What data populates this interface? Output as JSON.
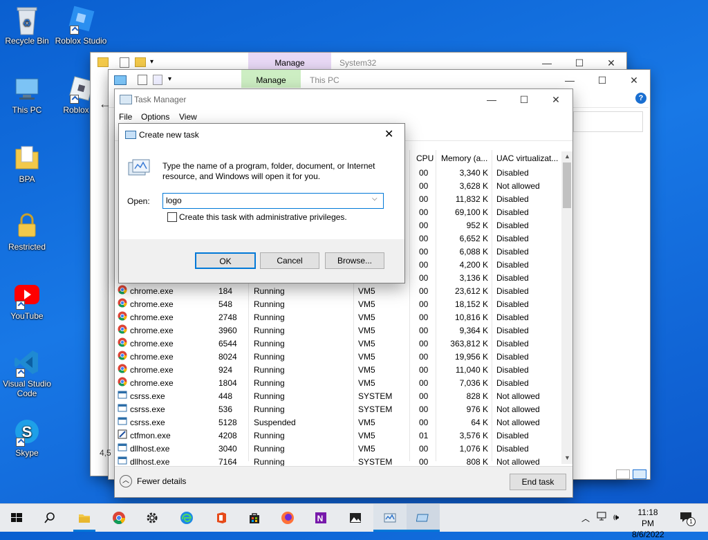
{
  "desktop": {
    "icons": [
      {
        "label": "Recycle Bin"
      },
      {
        "label": "Roblox Studio"
      },
      {
        "label": "This PC"
      },
      {
        "label": "Roblox Pl"
      },
      {
        "label": "BPA"
      },
      {
        "label": "Restricted"
      },
      {
        "label": "YouTube"
      },
      {
        "label": "Visual Studio Code"
      },
      {
        "label": "Skype"
      }
    ]
  },
  "explorer_back": {
    "manage_label": "Manage",
    "title": "System32"
  },
  "explorer_front": {
    "manage_label": "Manage",
    "title": "This PC",
    "status_left": "4,5"
  },
  "task_manager": {
    "title": "Task Manager",
    "menu": [
      "File",
      "Options",
      "View"
    ],
    "columns": {
      "cpu": "CPU",
      "memory": "Memory (a...",
      "uac": "UAC virtualizat..."
    },
    "partial_rows": [
      {
        "cpu": "00",
        "memory": "3,340 K",
        "uac": "Disabled"
      },
      {
        "cpu": "00",
        "memory": "3,628 K",
        "uac": "Not allowed"
      },
      {
        "cpu": "00",
        "memory": "11,832 K",
        "uac": "Disabled"
      },
      {
        "cpu": "00",
        "memory": "69,100 K",
        "uac": "Disabled"
      },
      {
        "cpu": "00",
        "memory": "952 K",
        "uac": "Disabled"
      },
      {
        "cpu": "00",
        "memory": "6,652 K",
        "uac": "Disabled"
      },
      {
        "cpu": "00",
        "memory": "6,088 K",
        "uac": "Disabled"
      },
      {
        "cpu": "00",
        "memory": "4,200 K",
        "uac": "Disabled"
      },
      {
        "cpu": "00",
        "memory": "3,136 K",
        "uac": "Disabled"
      }
    ],
    "rows": [
      {
        "icon": "chrome",
        "name": "chrome.exe",
        "pid": "184",
        "status": "Running",
        "user": "VM5",
        "cpu": "00",
        "memory": "23,612 K",
        "uac": "Disabled"
      },
      {
        "icon": "chrome",
        "name": "chrome.exe",
        "pid": "548",
        "status": "Running",
        "user": "VM5",
        "cpu": "00",
        "memory": "18,152 K",
        "uac": "Disabled"
      },
      {
        "icon": "chrome",
        "name": "chrome.exe",
        "pid": "2748",
        "status": "Running",
        "user": "VM5",
        "cpu": "00",
        "memory": "10,816 K",
        "uac": "Disabled"
      },
      {
        "icon": "chrome",
        "name": "chrome.exe",
        "pid": "3960",
        "status": "Running",
        "user": "VM5",
        "cpu": "00",
        "memory": "9,364 K",
        "uac": "Disabled"
      },
      {
        "icon": "chrome",
        "name": "chrome.exe",
        "pid": "6544",
        "status": "Running",
        "user": "VM5",
        "cpu": "00",
        "memory": "363,812 K",
        "uac": "Disabled"
      },
      {
        "icon": "chrome",
        "name": "chrome.exe",
        "pid": "8024",
        "status": "Running",
        "user": "VM5",
        "cpu": "00",
        "memory": "19,956 K",
        "uac": "Disabled"
      },
      {
        "icon": "chrome",
        "name": "chrome.exe",
        "pid": "924",
        "status": "Running",
        "user": "VM5",
        "cpu": "00",
        "memory": "11,040 K",
        "uac": "Disabled"
      },
      {
        "icon": "chrome",
        "name": "chrome.exe",
        "pid": "1804",
        "status": "Running",
        "user": "VM5",
        "cpu": "00",
        "memory": "7,036 K",
        "uac": "Disabled"
      },
      {
        "icon": "window",
        "name": "csrss.exe",
        "pid": "448",
        "status": "Running",
        "user": "SYSTEM",
        "cpu": "00",
        "memory": "828 K",
        "uac": "Not allowed"
      },
      {
        "icon": "window",
        "name": "csrss.exe",
        "pid": "536",
        "status": "Running",
        "user": "SYSTEM",
        "cpu": "00",
        "memory": "976 K",
        "uac": "Not allowed"
      },
      {
        "icon": "window",
        "name": "csrss.exe",
        "pid": "5128",
        "status": "Suspended",
        "user": "VM5",
        "cpu": "00",
        "memory": "64 K",
        "uac": "Not allowed"
      },
      {
        "icon": "pen",
        "name": "ctfmon.exe",
        "pid": "4208",
        "status": "Running",
        "user": "VM5",
        "cpu": "01",
        "memory": "3,576 K",
        "uac": "Disabled"
      },
      {
        "icon": "window",
        "name": "dllhost.exe",
        "pid": "3040",
        "status": "Running",
        "user": "VM5",
        "cpu": "00",
        "memory": "1,076 K",
        "uac": "Disabled"
      },
      {
        "icon": "window",
        "name": "dllhost.exe",
        "pid": "7164",
        "status": "Running",
        "user": "SYSTEM",
        "cpu": "00",
        "memory": "808 K",
        "uac": "Not allowed"
      }
    ],
    "fewer_details": "Fewer details",
    "end_task": "End task"
  },
  "dialog": {
    "title": "Create new task",
    "description": "Type the name of a program, folder, document, or Internet resource, and Windows will open it for you.",
    "open_label": "Open:",
    "open_value": "logo",
    "admin_checkbox_label": "Create this task with administrative privileges.",
    "admin_checked": false,
    "ok": "OK",
    "cancel": "Cancel",
    "browse": "Browse..."
  },
  "taskbar": {
    "icons": [
      "start-icon",
      "search-icon",
      "file-explorer-icon",
      "chrome-icon",
      "settings-icon",
      "edge-icon",
      "office-icon",
      "store-icon",
      "firefox-icon",
      "onenote-icon",
      "photos-icon",
      "task-manager-icon",
      "run-dialog-icon"
    ],
    "time": "11:18 PM",
    "date": "8/6/2022",
    "notification_count": "1"
  },
  "colors": {
    "accent": "#0078d7",
    "manage_back": "#e8d8f5",
    "manage_front": "#cdeec3"
  }
}
